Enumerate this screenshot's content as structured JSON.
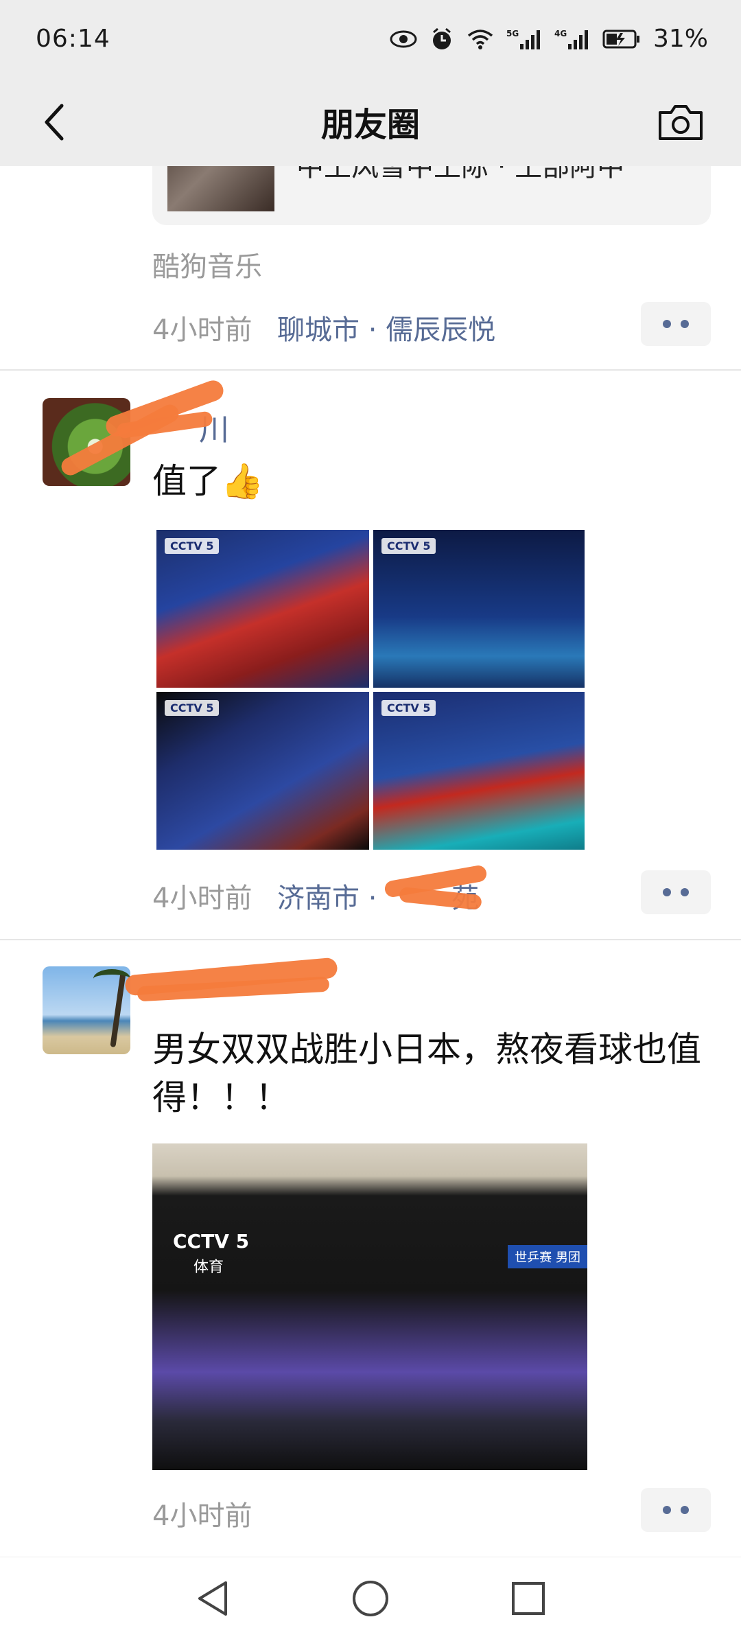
{
  "status_bar": {
    "time": "06:14",
    "icons": [
      "eye-icon",
      "alarm-icon",
      "wifi-icon",
      "signal-5g-icon",
      "signal-4g-icon",
      "battery-icon"
    ],
    "signal_1": "5G",
    "signal_2": "4G",
    "battery": "31%"
  },
  "nav": {
    "title": "朋友圈"
  },
  "posts": [
    {
      "share_text": "中土风雪中土际 · 土部阿中",
      "source": "酷狗音乐",
      "time": "4小时前",
      "location": "聊城市 · 儒辰辰悦"
    },
    {
      "name": "川",
      "text": "值了👍",
      "image_labels": [
        "CCTV 5",
        "CCTV 5",
        "CCTV 5",
        "CCTV 5"
      ],
      "time": "4小时前",
      "location": "济南市 · ",
      "location_tail": "苑"
    },
    {
      "name": "",
      "text": "男女双双战胜小日本，熬夜看球也值得！！！",
      "image_logo": "CCTV 5",
      "image_sub": "体育",
      "image_tag": "世乒赛 男团",
      "time": "4小时前"
    }
  ],
  "colors": {
    "link": "#576b95",
    "meta_gray": "#9a9a9a",
    "header_bg": "#ededed",
    "redaction": "#f47b3c"
  }
}
